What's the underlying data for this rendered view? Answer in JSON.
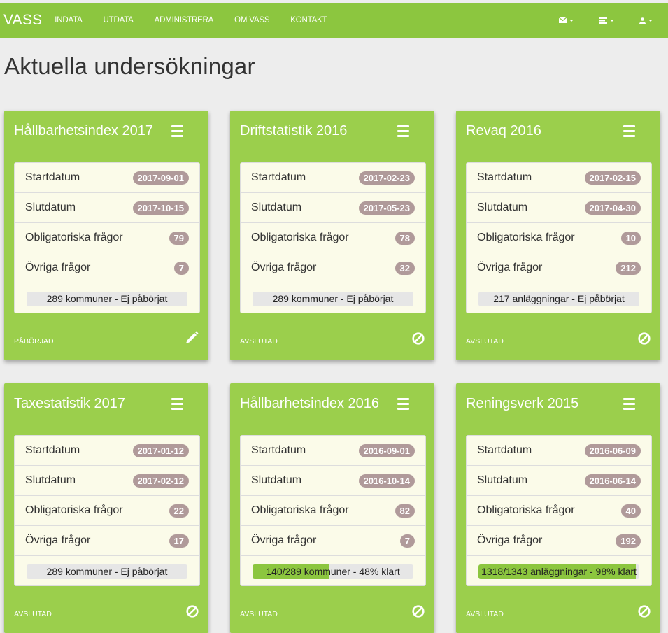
{
  "app": {
    "brand": "VASS",
    "nav": [
      "INDATA",
      "UTDATA",
      "ADMINISTRERA",
      "OM VASS",
      "KONTAKT"
    ],
    "icons": [
      "envelope-icon",
      "list-icon",
      "user-icon"
    ],
    "accent_color": "#8cc63f"
  },
  "page": {
    "title": "Aktuella undersökningar"
  },
  "labels": {
    "start": "Startdatum",
    "end": "Slutdatum",
    "mandatory": "Obligatoriska frågor",
    "other": "Övriga frågor"
  },
  "cards": [
    {
      "title": "Hållbarhetsindex 2017",
      "start": "2017-09-01",
      "end": "2017-10-15",
      "mandatory": "79",
      "other": "7",
      "progress_text": "289 kommuner - Ej påbörjat",
      "progress_fraction": 0,
      "status": "PÅBÖRJAD",
      "action_icon": "pencil-icon"
    },
    {
      "title": "Driftstatistik 2016",
      "start": "2017-02-23",
      "end": "2017-05-23",
      "mandatory": "78",
      "other": "32",
      "progress_text": "289 kommuner - Ej påbörjat",
      "progress_fraction": 0,
      "status": "AVSLUTAD",
      "action_icon": "ban-icon"
    },
    {
      "title": "Revaq 2016",
      "start": "2017-02-15",
      "end": "2017-04-30",
      "mandatory": "10",
      "other": "212",
      "progress_text": "217 anläggningar - Ej påbörjat",
      "progress_fraction": 0,
      "status": "AVSLUTAD",
      "action_icon": "ban-icon"
    },
    {
      "title": "Taxestatistik 2017",
      "start": "2017-01-12",
      "end": "2017-02-12",
      "mandatory": "22",
      "other": "17",
      "progress_text": "289 kommuner - Ej påbörjat",
      "progress_fraction": 0,
      "status": "AVSLUTAD",
      "action_icon": "ban-icon"
    },
    {
      "title": "Hållbarhetsindex 2016",
      "start": "2016-09-01",
      "end": "2016-10-14",
      "mandatory": "82",
      "other": "7",
      "progress_text": "140/289 kommuner - 48% klart",
      "progress_fraction": 0.48,
      "status": "AVSLUTAD",
      "action_icon": "ban-icon"
    },
    {
      "title": "Reningsverk 2015",
      "start": "2016-06-09",
      "end": "2016-06-14",
      "mandatory": "40",
      "other": "192",
      "progress_text": "1318/1343 anläggningar - 98% klart",
      "progress_fraction": 0.98,
      "status": "AVSLUTAD",
      "action_icon": "ban-icon"
    }
  ]
}
